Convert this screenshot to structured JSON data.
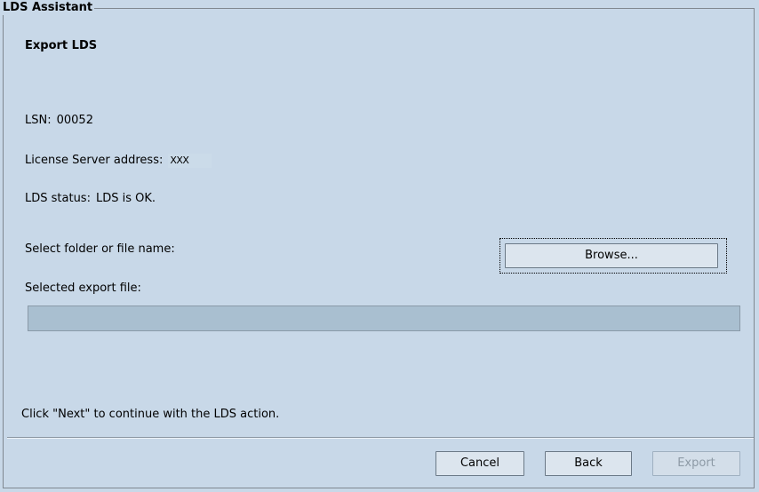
{
  "window": {
    "group_title": "LDS Assistant"
  },
  "page": {
    "heading": "Export LDS",
    "lsn_label": "LSN:",
    "lsn_value": "00052",
    "server_label": "License Server address:",
    "server_value": "XXX",
    "status_label": "LDS status:",
    "status_value": "LDS is OK.",
    "select_label": "Select folder or file name:",
    "browse_label": "Browse...",
    "export_file_label": "Selected export file:",
    "export_file_value": "",
    "hint": "Click \"Next\" to continue with the LDS action."
  },
  "footer": {
    "cancel_label": "Cancel",
    "back_label": "Back",
    "export_label": "Export",
    "export_enabled": false
  },
  "colors": {
    "background": "#c8d8e8",
    "field_background": "#a9bfd0",
    "button_background": "#dce5ee",
    "disabled_text": "#8d9aa6"
  }
}
